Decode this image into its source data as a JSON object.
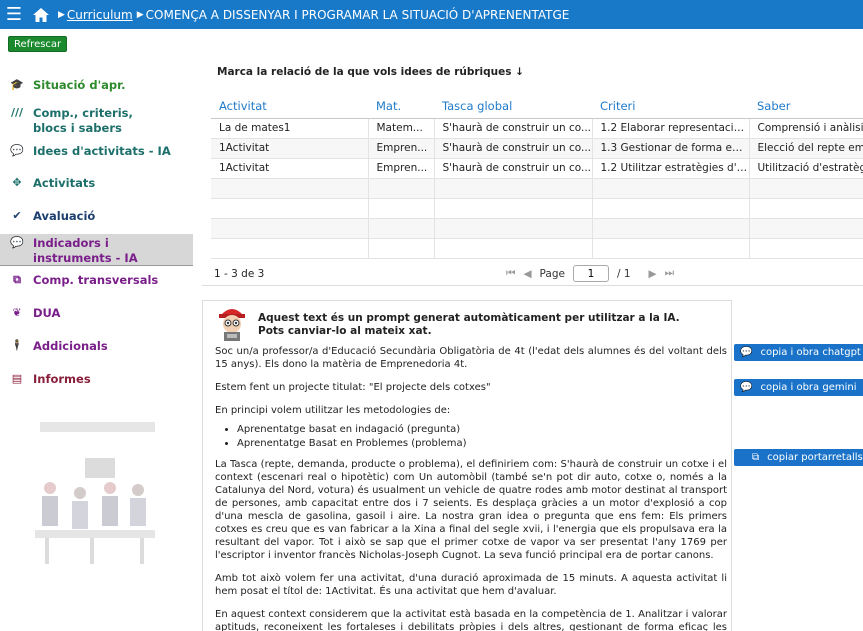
{
  "header": {
    "breadcrumb": [
      "Curriculum",
      "COMENÇA A DISSENYAR I PROGRAMAR LA SITUACIÓ D'APRENENTATGE"
    ]
  },
  "toolbar": {
    "refresh_label": "Refrescar"
  },
  "sidebar": {
    "items": [
      {
        "label": "Situació d'apr.",
        "color": "#2d8a2d",
        "icon": "graduation-cap-icon"
      },
      {
        "label": "Comp., criteris,",
        "label2": "blocs i sabers",
        "color": "#1c6f6a",
        "icon": "books-icon"
      },
      {
        "label": "Idees d'activitats - IA",
        "color": "#1c6f6a",
        "icon": "chat-bubble-icon"
      },
      {
        "label": "Activitats",
        "color": "#1c6f6a",
        "icon": "arrows-icon"
      },
      {
        "label": "Avaluació",
        "color": "#1c3f6f",
        "icon": "check-icon"
      },
      {
        "label": "Indicadors i",
        "label2": "instruments - IA",
        "color": "#7a1f8a",
        "icon": "chat-bubble-icon"
      },
      {
        "label": "Comp. transversals",
        "color": "#7a1f8a",
        "icon": "export-icon"
      },
      {
        "label": "DUA",
        "color": "#7a1f8a",
        "icon": "brain-icon"
      },
      {
        "label": "Addicionals",
        "color": "#7a1f8a",
        "icon": "person-icon"
      },
      {
        "label": "Informes",
        "color": "#8a1f3a",
        "icon": "document-icon"
      }
    ]
  },
  "main": {
    "question": "Marca la relació de la que vols idees de rúbriques ↓",
    "table": {
      "columns": [
        "Activitat",
        "Mat.",
        "Tasca global",
        "Criteri",
        "Saber"
      ],
      "rows": [
        [
          "La de mates1",
          "Matem...",
          "S'haurà de construir un co...",
          "1.2 Elaborar representacio...",
          "Comprensió i anàlisi d..."
        ],
        [
          "1Activitat",
          "Empren...",
          "S'haurà de construir un co...",
          "1.3 Gestionar de forma efi...",
          "Elecció del repte emp..."
        ],
        [
          "1Activitat",
          "Empren...",
          "S'haurà de construir un co...",
          "1.2 Utilitzar estratègies d'a...",
          "Utilització d'estratègie..."
        ]
      ],
      "empty_rows": 4
    },
    "pager": {
      "count": "1 - 3 de 3",
      "page_label": "Page",
      "page_value": "1",
      "of_label": "/ 1"
    },
    "prompt": {
      "head1": "Aquest text és un prompt generat automàticament per utilitzar a la IA.",
      "head2": "Pots canviar-lo al mateix xat.",
      "p1": "Soc un/a professor/a d'Educació Secundària Obligatòria de 4t (l'edat dels alumnes és del voltant dels 15 anys). Els dono la matèria de Emprenedoria 4t.",
      "p2": "Estem fent un projecte titulat: \"El projecte dels cotxes\"",
      "p3": "En principi volem utilitzar les metodologies de:",
      "li1": "Aprenentatge basat en indagació (pregunta)",
      "li2": "Aprenentatge Basat en Problemes (problema)",
      "p4": "La Tasca (repte, demanda, producte o problema), el definiriem com: S'haurà de construir un cotxe i el context (escenari real o hipotètic) com Un automòbil (també se'n pot dir auto, cotxe o, només a la Catalunya del Nord, votura) és usualment un vehicle de quatre rodes amb motor destinat al transport de persones, amb capacitat entre dos i 7 seients. Es desplaça gràcies a un motor d'explosió a cop d'una mescla de gasolina, gasoil i aire. La nostra gran idea o pregunta que ens fem: Els primers cotxes es creu que es van fabricar a la Xina a final del segle xvii, i l'energia que els propulsava era la resultant del vapor. Tot i això se sap que el primer cotxe de vapor va ser presentat l'any 1769 per l'escriptor i inventor francès Nicholas-Joseph Cugnot. La seva funció principal era de portar canons.",
      "p5": "Amb tot això volem fer una activitat, d'una duració aproximada de 15 minuts. A aquesta activitat li hem posat el títol de: 1Activitat. És una activitat que hem d'avaluar.",
      "p6": "En aquest context considerem que la activitat està basada en la competència de 1. Analitzar i valorar aptituds, reconeixent les fortaleses i debilitats pròpies i dels altres, gestionant de forma eficaç les emocions i destreses"
    },
    "actions": {
      "chatgpt": "copia i obra chatgpt",
      "gemini": "copia i obra gemini",
      "clipboard": "copiar portarretalls"
    }
  }
}
